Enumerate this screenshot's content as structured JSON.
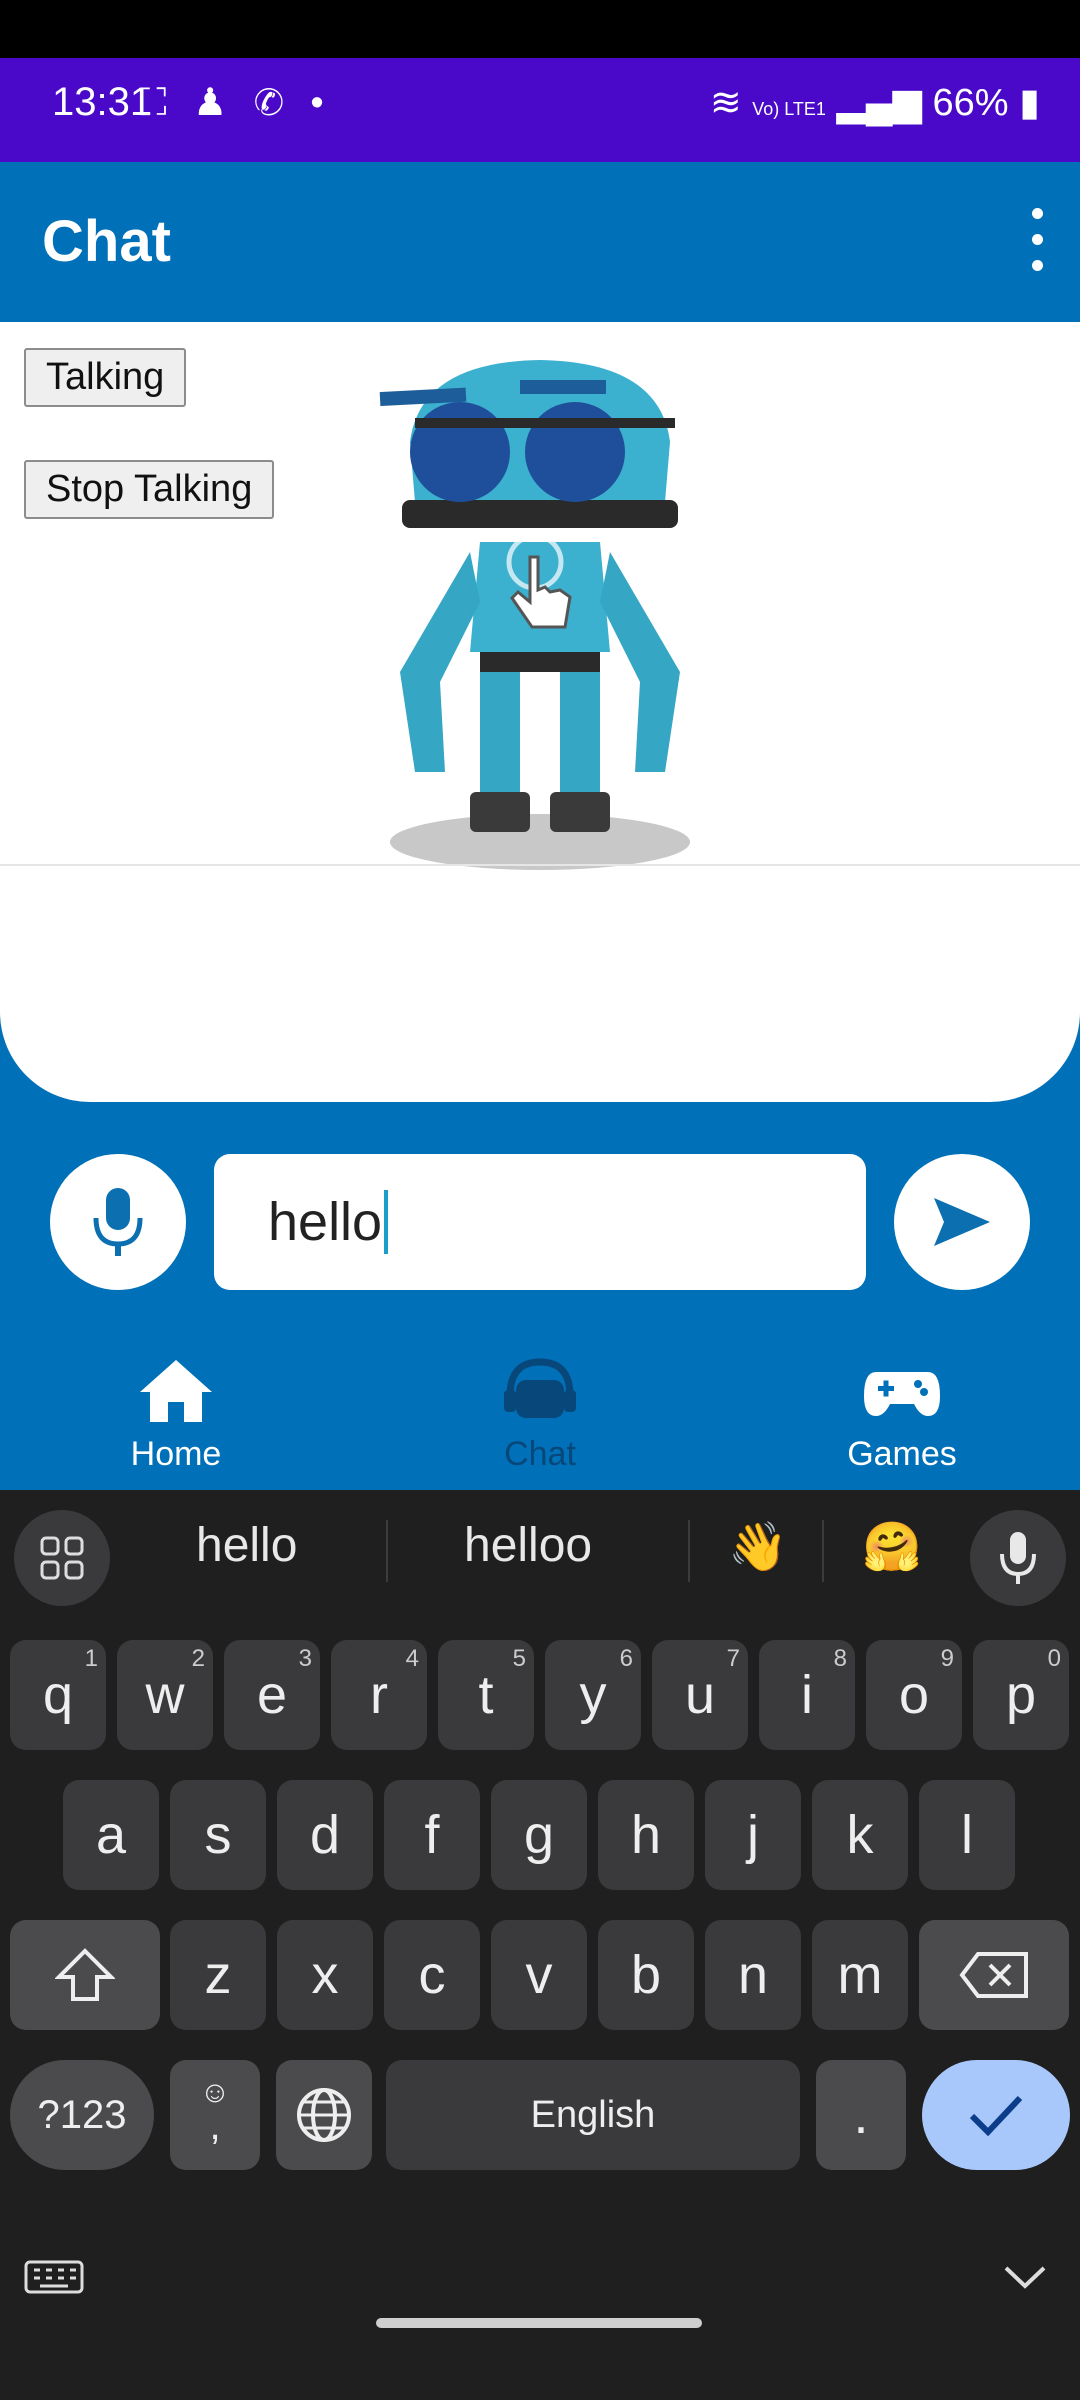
{
  "status_bar": {
    "time": "13:31",
    "battery": "66%",
    "network": "Vo) LTE1",
    "icons": [
      "screenshot-icon",
      "notification-icon",
      "phone-icon",
      "dot-icon",
      "wifi-icon",
      "signal-icon",
      "battery-icon"
    ]
  },
  "app_bar": {
    "title": "Chat",
    "menu_icon": "more-vert-icon"
  },
  "robot_panel": {
    "talking_button": "Talking",
    "stop_button": "Stop Talking"
  },
  "composer": {
    "mic_icon": "mic-icon",
    "input_value": "hello",
    "send_icon": "send-icon"
  },
  "bottom_nav": {
    "items": [
      {
        "label": "Home",
        "icon": "home-icon"
      },
      {
        "label": "Chat",
        "icon": "chat-headset-icon"
      },
      {
        "label": "Games",
        "icon": "gamepad-icon"
      }
    ],
    "active": "Chat"
  },
  "keyboard": {
    "suggestions": [
      "hello",
      "helloo"
    ],
    "emoji_suggestions": [
      "👋",
      "🤗"
    ],
    "row1": [
      "q",
      "w",
      "e",
      "r",
      "t",
      "y",
      "u",
      "i",
      "o",
      "p"
    ],
    "row1_hints": [
      "1",
      "2",
      "3",
      "4",
      "5",
      "6",
      "7",
      "8",
      "9",
      "0"
    ],
    "row2": [
      "a",
      "s",
      "d",
      "f",
      "g",
      "h",
      "j",
      "k",
      "l"
    ],
    "row3": [
      "z",
      "x",
      "c",
      "v",
      "b",
      "n",
      "m"
    ],
    "numbers_key": "?123",
    "comma_key": ",",
    "space_label": "English",
    "period_key": "."
  },
  "colors": {
    "status_bar": "#4a09c9",
    "primary": "#0070b8",
    "keyboard_bg": "#1f1f1f",
    "enter_key": "#a8c7fa"
  }
}
